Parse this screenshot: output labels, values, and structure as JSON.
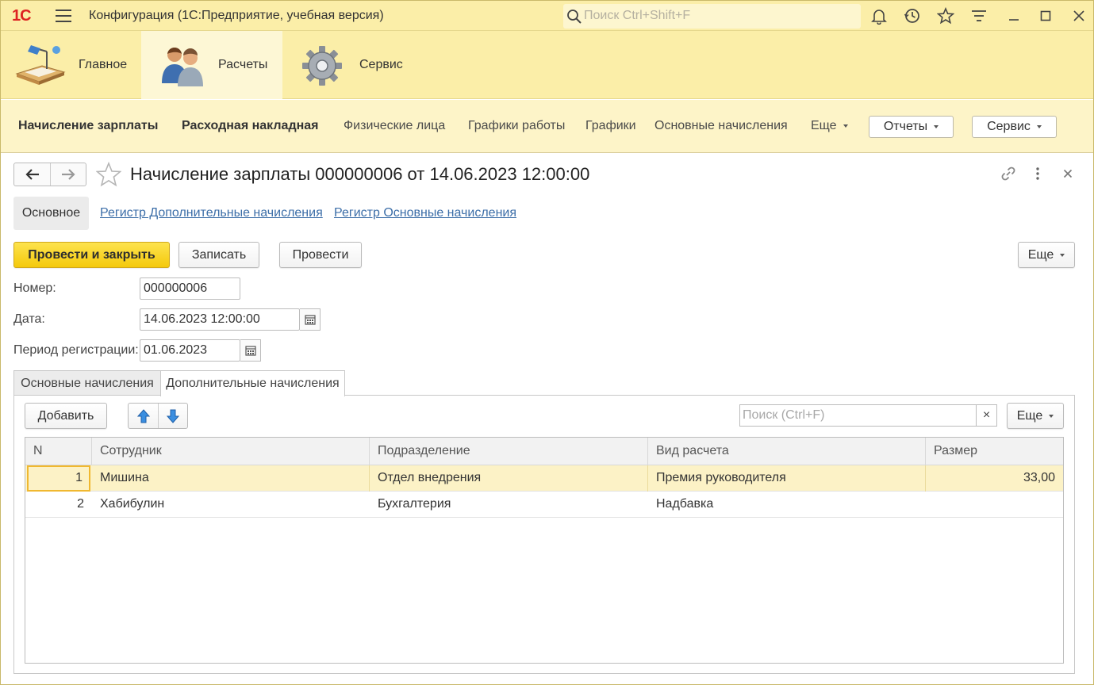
{
  "titlebar": {
    "logo": "1С",
    "title": "Конфигурация  (1С:Предприятие, учебная версия)",
    "search_placeholder": "Поиск Ctrl+Shift+F"
  },
  "sections": [
    {
      "label": "Главное"
    },
    {
      "label": "Расчеты"
    },
    {
      "label": "Сервис"
    }
  ],
  "funcbar": {
    "items": [
      "Начисление зарплаты",
      "Расходная накладная",
      "Физические лица",
      "Графики работы",
      "Графики",
      "Основные начисления",
      "Еще"
    ],
    "reports_label": "Отчеты",
    "service_label": "Сервис"
  },
  "form": {
    "title": "Начисление зарплаты 000000006 от 14.06.2023 12:00:00",
    "tab_main": "Основное",
    "link_additional": "Регистр Дополнительные начисления",
    "link_basic": "Регистр Основные начисления",
    "btn_post_close": "Провести и закрыть",
    "btn_save": "Записать",
    "btn_post": "Провести",
    "btn_more": "Еще",
    "number_label": "Номер:",
    "number_value": "000000006",
    "date_label": "Дата:",
    "date_value": "14.06.2023 12:00:00",
    "period_label": "Период регистрации:",
    "period_value": "01.06.2023"
  },
  "tabs": [
    {
      "label": "Основные начисления",
      "active": false
    },
    {
      "label": "Дополнительные начисления",
      "active": true
    }
  ],
  "table_toolbar": {
    "add_label": "Добавить",
    "search_placeholder": "Поиск (Ctrl+F)",
    "clear": "×",
    "more_label": "Еще"
  },
  "table": {
    "columns": [
      "N",
      "Сотрудник",
      "Подразделение",
      "Вид расчета",
      "Размер"
    ],
    "rows": [
      {
        "n": "1",
        "employee": "Мишина",
        "department": "Отдел внедрения",
        "calc_type": "Премия руководителя",
        "amount": "33,00",
        "selected": true
      },
      {
        "n": "2",
        "employee": "Хабибулин",
        "department": "Бухгалтерия",
        "calc_type": "Надбавка",
        "amount": "",
        "selected": false
      }
    ]
  },
  "colors": {
    "panel_yellow": "#fbeea8",
    "primary_button": "#f4c90c",
    "link_blue": "#3c6ea8",
    "logo_red": "#dd2222"
  }
}
